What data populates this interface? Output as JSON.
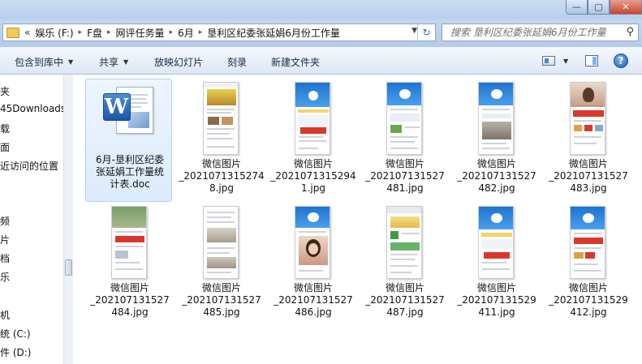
{
  "window": {
    "controls": {
      "minimize": "—",
      "maximize": "▢",
      "close": "✕"
    }
  },
  "address": {
    "overflow": "«",
    "crumbs": [
      "娱乐 (F:)",
      "F盘",
      "网评任务量",
      "6月",
      "垦利区纪委张延娟6月份工作量"
    ],
    "separator": "▸",
    "refresh_icon": "refresh-icon"
  },
  "search": {
    "placeholder": "搜索 垦利区纪委张延娟6月份工作量",
    "icon": "search-icon"
  },
  "toolbar": {
    "include_library": "包含到库中",
    "share": "共享",
    "slideshow": "放映幻灯片",
    "burn": "刻录",
    "new_folder": "新建文件夹",
    "help": "?"
  },
  "nav": {
    "items": [
      "夹",
      "45Downloads",
      "载",
      "面",
      "近访问的位置",
      "频",
      "片",
      "档",
      "乐",
      "机",
      "统 (C:)",
      "件 (D:)"
    ]
  },
  "files": [
    {
      "name": "6月-垦利区纪委张延娟工作量统计表.doc",
      "type": "doc",
      "selected": true
    },
    {
      "name": "微信图片_2021071315274 8.jpg",
      "type": "jpg"
    },
    {
      "name": "微信图片_20210713152941.jpg",
      "type": "jpg"
    },
    {
      "name": "微信图片_202107131527481.jpg",
      "type": "jpg"
    },
    {
      "name": "微信图片_202107131527482.jpg",
      "type": "jpg"
    },
    {
      "name": "微信图片_202107131527483.jpg",
      "type": "jpg"
    },
    {
      "name": "微信图片_202107131527484.jpg",
      "type": "jpg"
    },
    {
      "name": "微信图片_202107131527485.jpg",
      "type": "jpg"
    },
    {
      "name": "微信图片_202107131527486.jpg",
      "type": "jpg"
    },
    {
      "name": "微信图片_202107131527487.jpg",
      "type": "jpg"
    },
    {
      "name": "微信图片_202107131529411.jpg",
      "type": "jpg"
    },
    {
      "name": "微信图片_202107131529412.jpg",
      "type": "jpg"
    }
  ],
  "labels": {
    "f0": [
      "6月-垦利区纪委",
      "张延娟工作量统",
      "计表.doc"
    ],
    "f1": [
      "微信图片",
      "_2021071315274",
      "8.jpg"
    ],
    "f2": [
      "微信图片",
      "_2021071315294",
      "1.jpg"
    ],
    "f3": [
      "微信图片",
      "_202107131527",
      "481.jpg"
    ],
    "f4": [
      "微信图片",
      "_202107131527",
      "482.jpg"
    ],
    "f5": [
      "微信图片",
      "_202107131527",
      "483.jpg"
    ],
    "f6": [
      "微信图片",
      "_202107131527",
      "484.jpg"
    ],
    "f7": [
      "微信图片",
      "_202107131527",
      "485.jpg"
    ],
    "f8": [
      "微信图片",
      "_202107131527",
      "486.jpg"
    ],
    "f9": [
      "微信图片",
      "_202107131527",
      "487.jpg"
    ],
    "f10": [
      "微信图片",
      "_202107131529",
      "411.jpg"
    ],
    "f11": [
      "微信图片",
      "_202107131529",
      "412.jpg"
    ]
  },
  "colors": {
    "accent": "#2b6fc4",
    "phone_header": "#1e73d2",
    "phone_red": "#d9382b"
  }
}
